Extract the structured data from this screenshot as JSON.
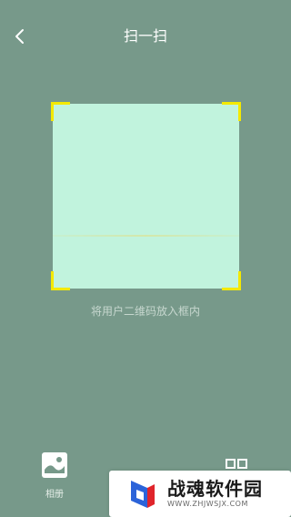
{
  "header": {
    "title": "扫一扫",
    "back_icon": "chevron-left-icon"
  },
  "scanner": {
    "hint": "将用户二维码放入框内",
    "frame_color": "#c1f3dd",
    "corner_color": "#f4e900"
  },
  "footer": {
    "album_label": "相册",
    "album_icon": "image-icon",
    "my_qr_icon": "qr-code-icon"
  },
  "watermark": {
    "name": "战魂软件园",
    "url": "WWW.ZHJWSJX.COM"
  }
}
